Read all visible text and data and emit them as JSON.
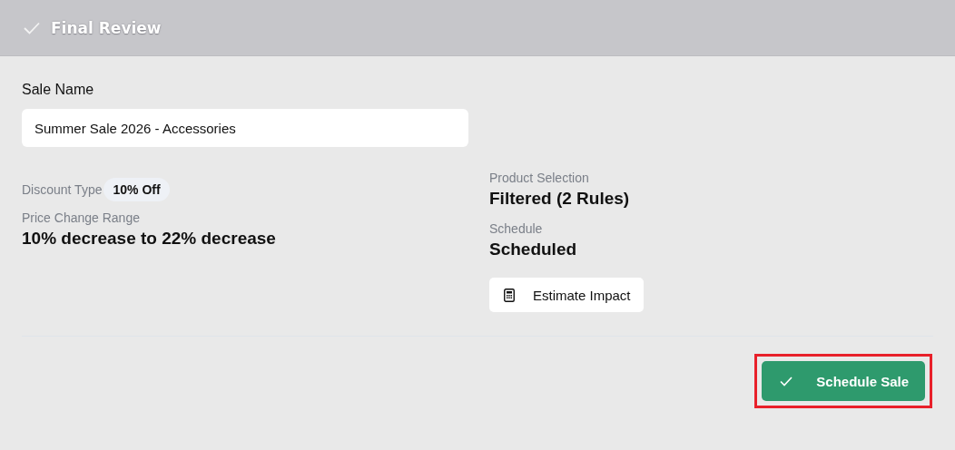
{
  "header": {
    "title": "Final Review"
  },
  "sale_name": {
    "label": "Sale Name",
    "value": "Summer Sale 2026 - Accessories"
  },
  "left_details": [
    {
      "kind": "badge",
      "label": "Discount Type",
      "value": "10% Off"
    },
    {
      "kind": "text",
      "label": "Price Change Range",
      "value": "10% decrease to 22% decrease"
    }
  ],
  "right_details": [
    {
      "label": "Product Selection",
      "value": "Filtered (2 Rules)"
    },
    {
      "label": "Schedule",
      "value": "Scheduled"
    }
  ],
  "estimate_button": {
    "label": "Estimate Impact"
  },
  "schedule_button": {
    "label": "Schedule Sale",
    "highlighted": true
  }
}
